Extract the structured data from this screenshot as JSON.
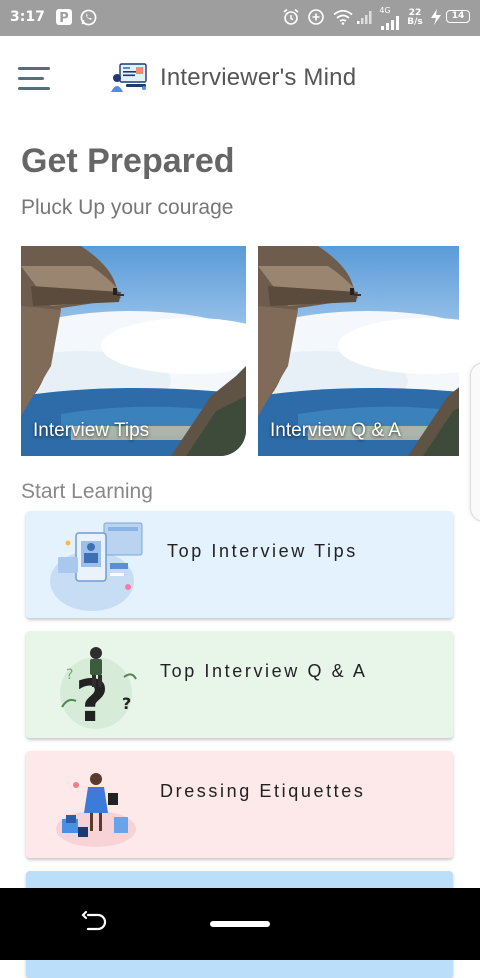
{
  "status_bar": {
    "time": "3:17",
    "network": "4G",
    "speed_value": "22",
    "speed_unit": "B/s",
    "battery": "14",
    "color": "#9e9e9e"
  },
  "app_bar": {
    "title": "Interviewer's Mind",
    "menu_icon": "hamburger-menu-icon",
    "logo_icon": "interview-logo-icon"
  },
  "hero": {
    "title": "Get Prepared",
    "subtitle": "Pluck Up your courage"
  },
  "carousel": [
    {
      "caption": "Interview Tips"
    },
    {
      "caption": "Interview Q & A"
    }
  ],
  "section": {
    "label": "Start Learning"
  },
  "learning_cards": [
    {
      "label": "Top Interview Tips",
      "color": "#e3f2fd",
      "icon": "online-learning-illustration"
    },
    {
      "label": "Top Interview Q & A",
      "color": "#e8f5e9",
      "icon": "question-person-illustration"
    },
    {
      "label": "Dressing Etiquettes",
      "color": "#fde8ea",
      "icon": "shopping-dress-illustration"
    },
    {
      "label": "",
      "color": "#bbdefb",
      "icon": ""
    }
  ]
}
